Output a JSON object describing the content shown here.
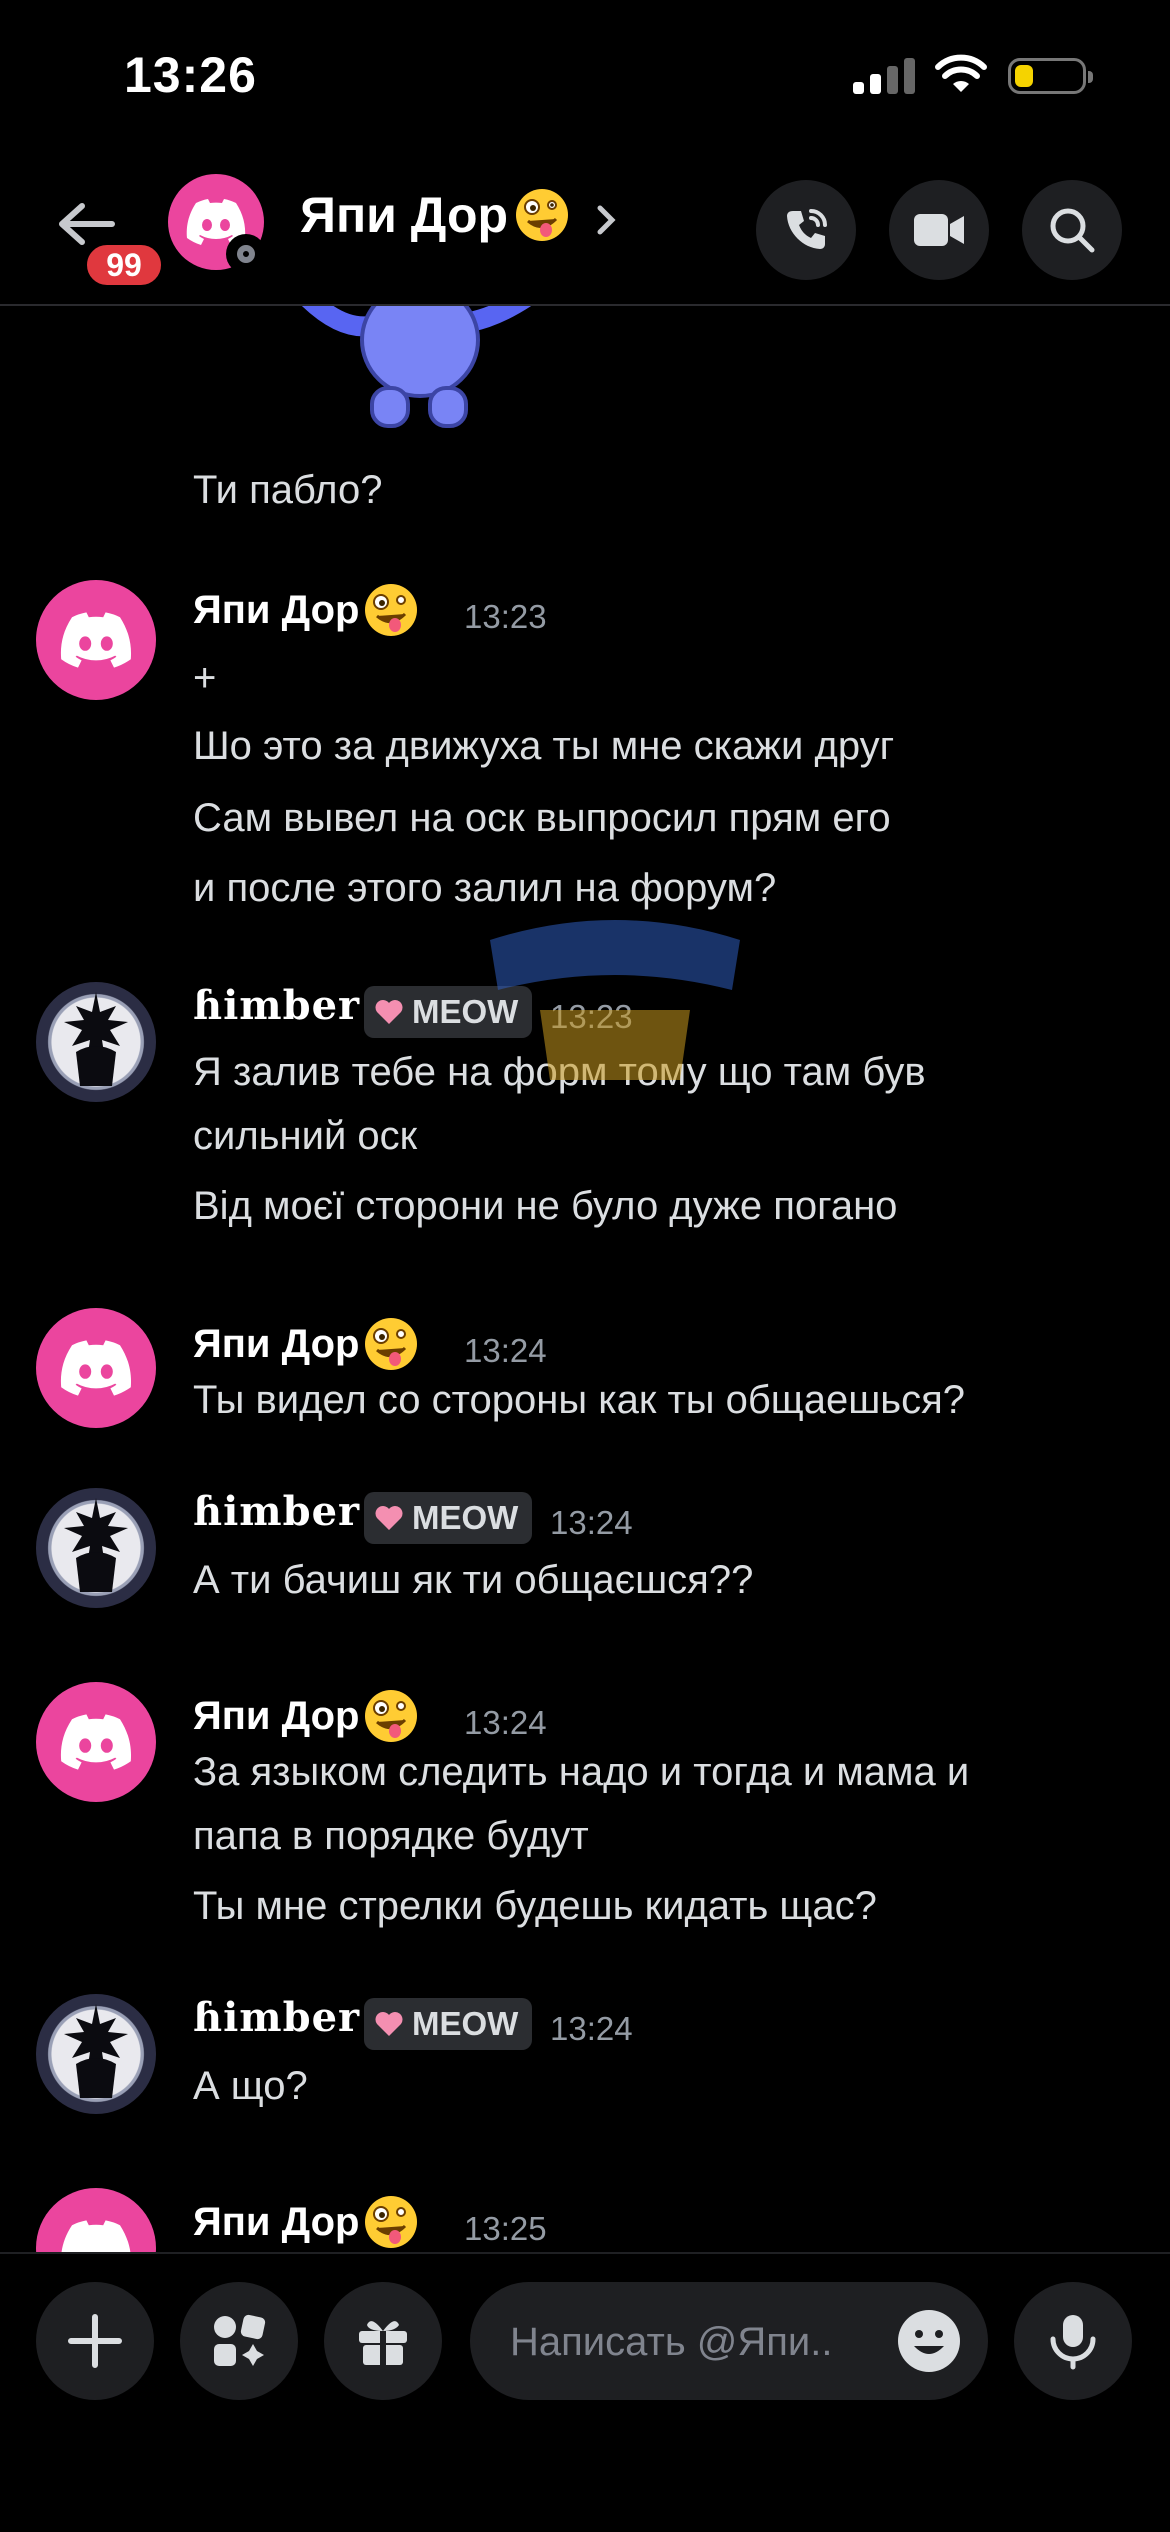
{
  "status_bar": {
    "time": "13:26",
    "battery_level": 0.2,
    "icons": [
      "signal-icon",
      "wifi-icon",
      "battery-icon"
    ]
  },
  "header": {
    "back_badge": "99",
    "title": "Япи Дор",
    "title_emoji": "zany-face-emoji",
    "actions": [
      "phone-call-icon",
      "video-camera-icon",
      "search-icon"
    ]
  },
  "colors": {
    "background": "#000000",
    "discord_avatar": "#eb459e",
    "badge": "#e0383e",
    "meta": "#949ba4",
    "text": "#dbdee1",
    "bubble": "#1e1f22"
  },
  "messages": [
    {
      "author": "",
      "lines": [
        "Ти пабло?"
      ]
    },
    {
      "author": "Япи Дор",
      "time": "13:23",
      "lines": [
        "+",
        "Шо это за движуха ты мне скажи друг",
        "Сам вывел на оск выпросил прям его",
        "и после этого залил на форум?"
      ]
    },
    {
      "author": "ɦimber",
      "tag": "MEOW",
      "time": "13:23",
      "lines": [
        "Я залив тебе на форм тому що там був",
        "сильний оск",
        "Від моєї сторони не було дуже погано"
      ]
    },
    {
      "author": "Япи Дор",
      "time": "13:24",
      "lines": [
        "Ты видел со стороны как ты общаешься?"
      ]
    },
    {
      "author": "ɦimber",
      "tag": "MEOW",
      "time": "13:24",
      "lines": [
        "А ти бачиш як ти общаєшся??"
      ]
    },
    {
      "author": "Япи Дор",
      "time": "13:24",
      "lines": [
        "За языком следить надо и тогда и мама и",
        "папа в порядке будут",
        "Ты мне стрелки будешь кидать щас?"
      ]
    },
    {
      "author": "ɦimber",
      "tag": "MEOW",
      "time": "13:24",
      "lines": [
        "А що?"
      ]
    },
    {
      "author": "Япи Дор",
      "time": "13:25",
      "lines": []
    }
  ],
  "composer": {
    "buttons": [
      "plus-icon",
      "apps-icon",
      "gift-icon",
      "microphone-icon"
    ],
    "placeholder": "Написать @Япи.."
  }
}
